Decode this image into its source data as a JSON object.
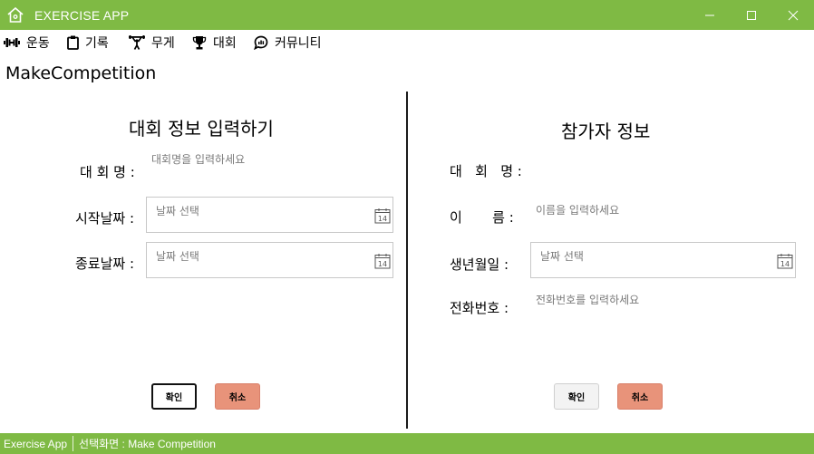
{
  "window": {
    "title": "EXERCISE APP",
    "accent_color": "#7fba44",
    "controls": [
      "minimize-icon",
      "maximize-icon",
      "close-icon"
    ]
  },
  "menu": {
    "items": [
      {
        "label": "운동",
        "icon": "dumbbell-icon"
      },
      {
        "label": "기록",
        "icon": "clipboard-icon"
      },
      {
        "label": "무게",
        "icon": "weightlifter-icon"
      },
      {
        "label": "대회",
        "icon": "trophy-icon"
      },
      {
        "label": "커뮤니티",
        "icon": "chat-icon"
      }
    ]
  },
  "page": {
    "title": "MakeCompetition"
  },
  "competition": {
    "heading": "대회 정보 입력하기",
    "name_label": "대 회 명 :",
    "name_placeholder": "대회명을 입력하세요",
    "start_label": "시작날짜 :",
    "start_placeholder": "날짜 선택",
    "end_label": "종료날짜 :",
    "end_placeholder": "날짜 선택",
    "confirm_label": "확인",
    "cancel_label": "취소"
  },
  "participant": {
    "heading": "참가자 정보",
    "competition_label": "대   회   명 :",
    "name_label": "이       름 :",
    "name_placeholder": "이름을 입력하세요",
    "birth_label": "생년월일 :",
    "birth_placeholder": "날짜 선택",
    "phone_label": "전화번호 :",
    "phone_placeholder": "전화번호를 입력하세요",
    "confirm_label": "확인",
    "cancel_label": "취소"
  },
  "calendar_day": "14",
  "status": {
    "app": "Exercise App",
    "screen": "선택화면 : Make Competition"
  },
  "colors": {
    "accent": "#7fba44",
    "cancel_button": "#e8937a"
  }
}
